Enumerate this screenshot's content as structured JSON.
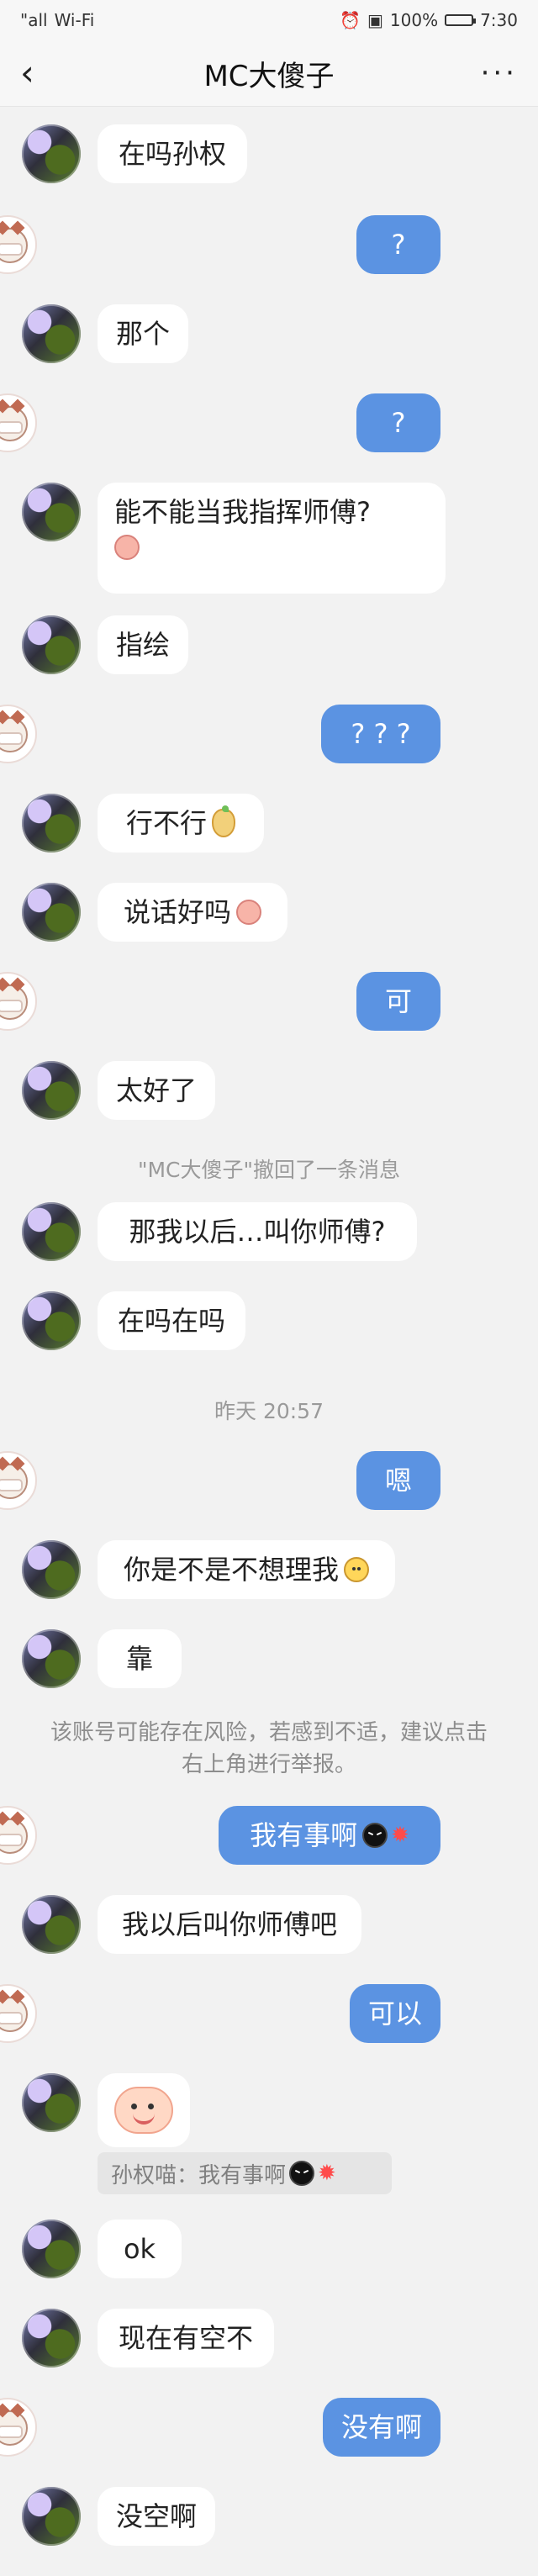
{
  "status": {
    "signal": "\"all",
    "wifi": "Wi‑Fi",
    "alarm": "⏰",
    "vibration": "▣",
    "battery_percent": "100%",
    "time": "7:30"
  },
  "header": {
    "title": "MC大傻子",
    "back": "‹",
    "more": "···"
  },
  "messages": [
    {
      "side": "left",
      "text": "在吗孙权"
    },
    {
      "side": "right",
      "text": "?"
    },
    {
      "side": "left",
      "text": "那个"
    },
    {
      "side": "right",
      "text": "?"
    },
    {
      "side": "left",
      "text": "能不能当我指挥师傅?"
    },
    {
      "side": "left",
      "text": "指绘"
    },
    {
      "side": "right",
      "text": "? ? ?"
    },
    {
      "side": "left",
      "text": "行不行"
    },
    {
      "side": "left",
      "text": "说话好吗"
    },
    {
      "side": "right",
      "text": "可"
    },
    {
      "side": "left",
      "text": "太好了"
    },
    {
      "side": "system",
      "text": "\"MC大傻子\"撤回了一条消息"
    },
    {
      "side": "left",
      "text": "那我以后…叫你师傅?"
    },
    {
      "side": "left",
      "text": "在吗在吗"
    },
    {
      "side": "system",
      "text": "昨天 20:57"
    },
    {
      "side": "right",
      "text": "嗯"
    },
    {
      "side": "left",
      "text": "你是不是不想理我"
    },
    {
      "side": "left",
      "text": "靠"
    },
    {
      "side": "notice",
      "text": "该账号可能存在风险，若感到不适，建议点击右上角进行举报。"
    },
    {
      "side": "right",
      "text": "我有事啊"
    },
    {
      "side": "left",
      "text": "我以后叫你师傅吧"
    },
    {
      "side": "right",
      "text": "可以"
    },
    {
      "side": "left",
      "text": ""
    },
    {
      "side": "reply",
      "text": "孙权喵：我有事啊"
    },
    {
      "side": "left",
      "text": "ok"
    },
    {
      "side": "left",
      "text": "现在有空不"
    },
    {
      "side": "right",
      "text": "没有啊"
    },
    {
      "side": "left",
      "text": "没空啊"
    }
  ]
}
